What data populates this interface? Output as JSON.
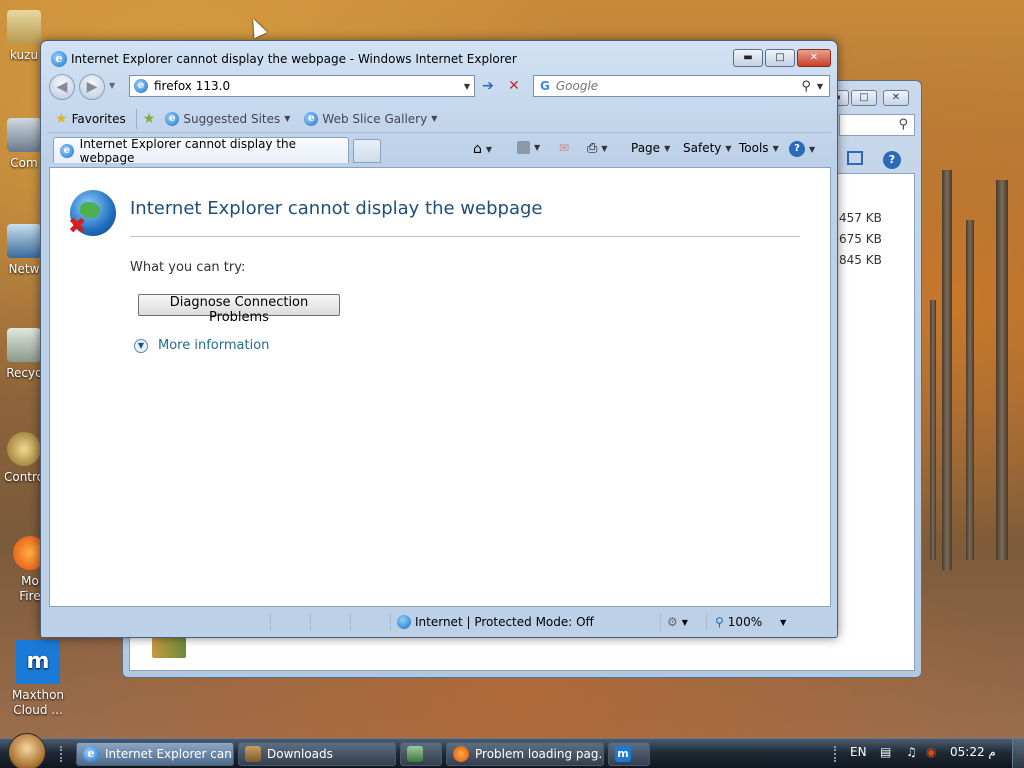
{
  "desktop": {
    "icons": [
      {
        "label": "kuzu"
      },
      {
        "label": "Com"
      },
      {
        "label": "Netw"
      },
      {
        "label": "Recyc"
      },
      {
        "label": "Contro"
      },
      {
        "label": "Mo\nFire"
      },
      {
        "label": "Maxthon\nCloud ..."
      }
    ]
  },
  "explorer_bg": {
    "sizes": [
      "457 KB",
      "675 KB",
      "845 KB"
    ]
  },
  "ie": {
    "window_title": "Internet Explorer cannot display the webpage - Windows Internet Explorer",
    "address": "firefox 113.0",
    "search_provider": "Google",
    "search_placeholder": "Google",
    "favorites_bar": {
      "favorites": "Favorites",
      "suggested_sites": "Suggested Sites",
      "web_slice_gallery": "Web Slice Gallery"
    },
    "tab_title": "Internet Explorer cannot display the webpage",
    "command_bar": {
      "page": "Page",
      "safety": "Safety",
      "tools": "Tools"
    },
    "page": {
      "heading": "Internet Explorer cannot display the webpage",
      "what_you_can_try": "What you can try:",
      "diagnose_button": "Diagnose Connection Problems",
      "more_information": "More information"
    },
    "status_bar": {
      "zone": "Internet | Protected Mode: Off",
      "zoom": "100%"
    }
  },
  "taskbar": {
    "items": [
      {
        "label": "Internet Explorer can...",
        "active": true
      },
      {
        "label": "Downloads",
        "active": false
      },
      {
        "label": "",
        "active": false
      },
      {
        "label": "Problem loading pag...",
        "active": false
      },
      {
        "label": "",
        "active": false
      }
    ],
    "language": "EN",
    "clock": "05:22 م"
  },
  "colors": {
    "ie_link": "#1f6e8e",
    "ie_heading": "#1f4e79",
    "close_red": "#c8402a"
  }
}
